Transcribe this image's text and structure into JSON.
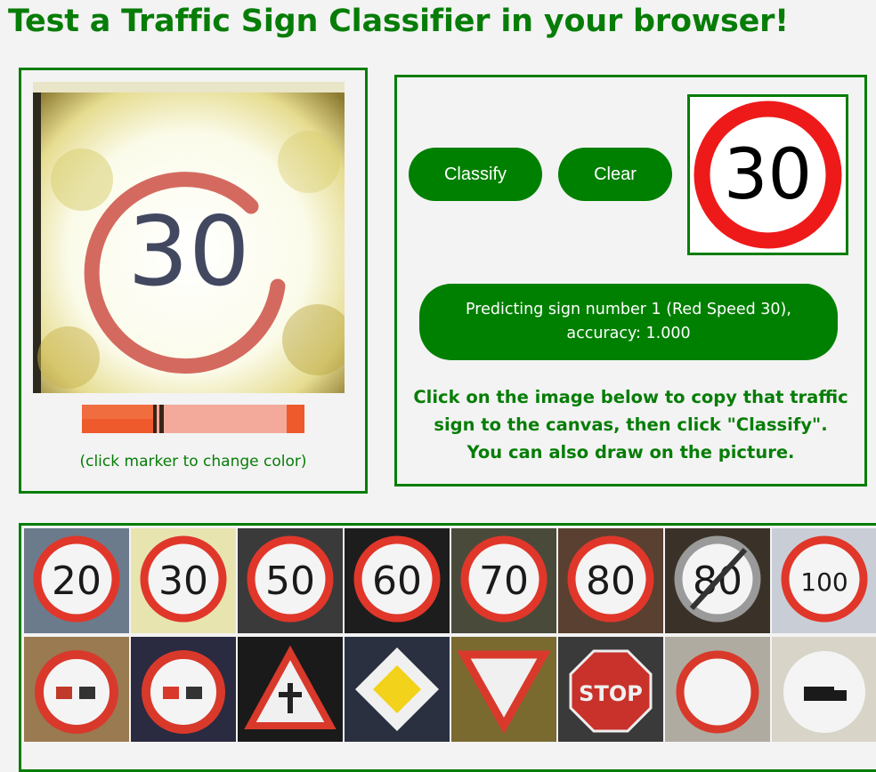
{
  "page": {
    "title": "Test a Traffic Sign Classifier in your browser!"
  },
  "canvas": {
    "sign_text": "30",
    "hint": "(click marker to change color)"
  },
  "marker": {
    "colors": [
      "#f05a28",
      "#f4a898"
    ],
    "selected_index": 0
  },
  "controls": {
    "classify_label": "Classify",
    "clear_label": "Clear"
  },
  "preview": {
    "sign_text": "30"
  },
  "prediction": {
    "line1": "Predicting sign number 1 (Red Speed 30),",
    "line2": "accuracy: 1.000"
  },
  "instructions": {
    "line1": "Click on the image below to copy that traffic",
    "line2": "sign to the canvas, then click \"Classify\".",
    "line3": "You can also draw on the picture."
  },
  "gallery": {
    "row1": [
      {
        "icon": "speed-limit-sign-icon",
        "text": "20"
      },
      {
        "icon": "speed-limit-sign-icon",
        "text": "30"
      },
      {
        "icon": "speed-limit-sign-icon",
        "text": "50"
      },
      {
        "icon": "speed-limit-sign-icon",
        "text": "60"
      },
      {
        "icon": "speed-limit-sign-icon",
        "text": "70"
      },
      {
        "icon": "speed-limit-sign-icon",
        "text": "80"
      },
      {
        "icon": "end-speed-limit-sign-icon",
        "text": "80"
      },
      {
        "icon": "speed-limit-sign-icon",
        "text": "100"
      }
    ],
    "row2": [
      {
        "icon": "no-passing-sign-icon"
      },
      {
        "icon": "no-passing-trucks-sign-icon"
      },
      {
        "icon": "right-of-way-sign-icon"
      },
      {
        "icon": "priority-road-sign-icon"
      },
      {
        "icon": "yield-sign-icon"
      },
      {
        "icon": "stop-sign-icon",
        "text": "STOP"
      },
      {
        "icon": "no-vehicles-sign-icon"
      },
      {
        "icon": "trucks-prohibited-sign-icon"
      }
    ]
  }
}
